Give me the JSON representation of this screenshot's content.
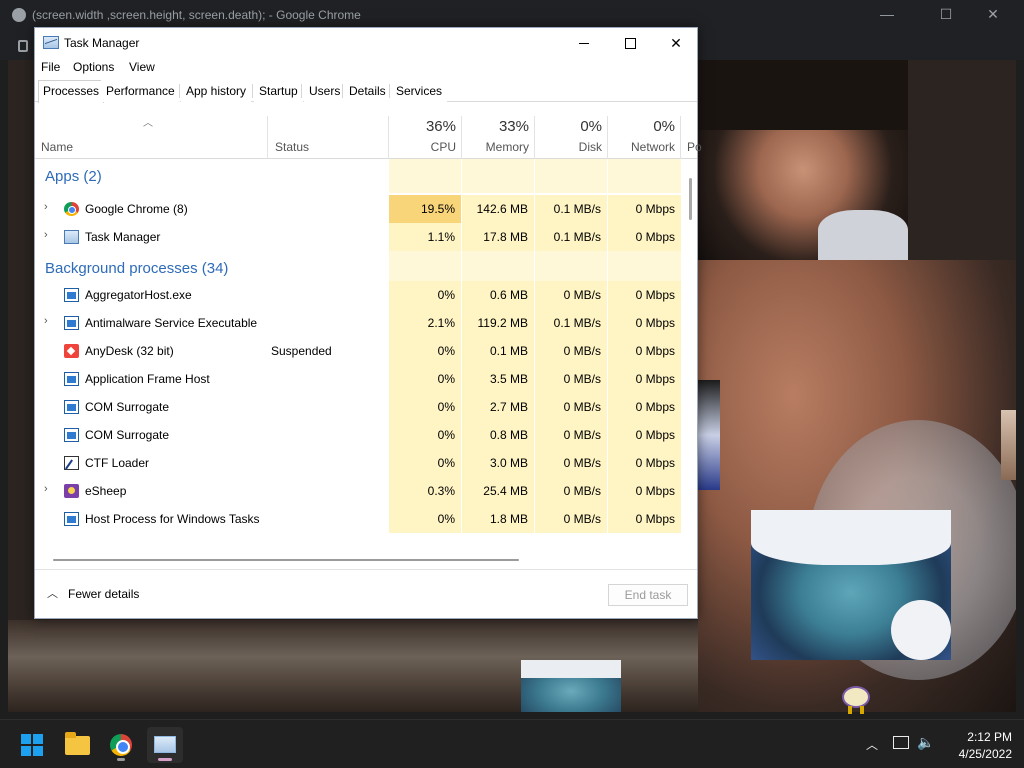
{
  "chrome": {
    "title": "(screen.width ,screen.height, screen.death); - Google Chrome",
    "minimize": "—",
    "maximize": "☐",
    "close": "✕"
  },
  "taskmgr": {
    "title": "Task Manager",
    "menu": [
      "File",
      "Options",
      "View"
    ],
    "tabs": [
      "Processes",
      "Performance",
      "App history",
      "Startup",
      "Users",
      "Details",
      "Services"
    ],
    "active_tab": "Processes",
    "columns": {
      "name": "Name",
      "status": "Status",
      "cpu": {
        "pct": "36%",
        "label": "CPU"
      },
      "memory": {
        "pct": "33%",
        "label": "Memory"
      },
      "disk": {
        "pct": "0%",
        "label": "Disk"
      },
      "network": {
        "pct": "0%",
        "label": "Network"
      },
      "power_partial": "Po"
    },
    "groups": [
      {
        "title": "Apps (2)",
        "rows": [
          {
            "name": "Google Chrome (8)",
            "icon": "chrome-icon",
            "expandable": true,
            "status": "",
            "cpu": "19.5%",
            "memory": "142.6 MB",
            "disk": "0.1 MB/s",
            "network": "0 Mbps",
            "cpu_heat": "high"
          },
          {
            "name": "Task Manager",
            "icon": "taskmgr-icon",
            "expandable": true,
            "status": "",
            "cpu": "1.1%",
            "memory": "17.8 MB",
            "disk": "0.1 MB/s",
            "network": "0 Mbps",
            "cpu_heat": "low"
          }
        ]
      },
      {
        "title": "Background processes (34)",
        "rows": [
          {
            "name": "AggregatorHost.exe",
            "icon": "window-icon",
            "expandable": false,
            "status": "",
            "cpu": "0%",
            "memory": "0.6 MB",
            "disk": "0 MB/s",
            "network": "0 Mbps",
            "cpu_heat": "low"
          },
          {
            "name": "Antimalware Service Executable",
            "icon": "window-icon",
            "expandable": true,
            "status": "",
            "cpu": "2.1%",
            "memory": "119.2 MB",
            "disk": "0.1 MB/s",
            "network": "0 Mbps",
            "cpu_heat": "low"
          },
          {
            "name": "AnyDesk (32 bit)",
            "icon": "anydesk-icon",
            "expandable": false,
            "status": "Suspended",
            "cpu": "0%",
            "memory": "0.1 MB",
            "disk": "0 MB/s",
            "network": "0 Mbps",
            "cpu_heat": "low"
          },
          {
            "name": "Application Frame Host",
            "icon": "window-icon",
            "expandable": false,
            "status": "",
            "cpu": "0%",
            "memory": "3.5 MB",
            "disk": "0 MB/s",
            "network": "0 Mbps",
            "cpu_heat": "low"
          },
          {
            "name": "COM Surrogate",
            "icon": "window-icon",
            "expandable": false,
            "status": "",
            "cpu": "0%",
            "memory": "2.7 MB",
            "disk": "0 MB/s",
            "network": "0 Mbps",
            "cpu_heat": "low"
          },
          {
            "name": "COM Surrogate",
            "icon": "window-icon",
            "expandable": false,
            "status": "",
            "cpu": "0%",
            "memory": "0.8 MB",
            "disk": "0 MB/s",
            "network": "0 Mbps",
            "cpu_heat": "low"
          },
          {
            "name": "CTF Loader",
            "icon": "ctf-loader-icon",
            "expandable": false,
            "status": "",
            "cpu": "0%",
            "memory": "3.0 MB",
            "disk": "0 MB/s",
            "network": "0 Mbps",
            "cpu_heat": "low"
          },
          {
            "name": "eSheep",
            "icon": "esheep-icon",
            "expandable": true,
            "status": "",
            "cpu": "0.3%",
            "memory": "25.4 MB",
            "disk": "0 MB/s",
            "network": "0 Mbps",
            "cpu_heat": "low"
          },
          {
            "name": "Host Process for Windows Tasks",
            "icon": "window-icon",
            "expandable": false,
            "status": "",
            "cpu": "0%",
            "memory": "1.8 MB",
            "disk": "0 MB/s",
            "network": "0 Mbps",
            "cpu_heat": "low"
          }
        ]
      }
    ],
    "footer": {
      "fewer_details": "Fewer details",
      "end_task": "End task"
    },
    "colors": {
      "heat_low": "#fff4c4",
      "heat_high": "#f9d57a",
      "heat_header": "#fef7d8",
      "group_title": "#2e6bb8"
    }
  },
  "taskbar": {
    "apps": [
      "start-icon",
      "file-explorer-icon",
      "chrome-icon",
      "task-manager-icon"
    ],
    "time": "2:12 PM",
    "date": "4/25/2022"
  }
}
